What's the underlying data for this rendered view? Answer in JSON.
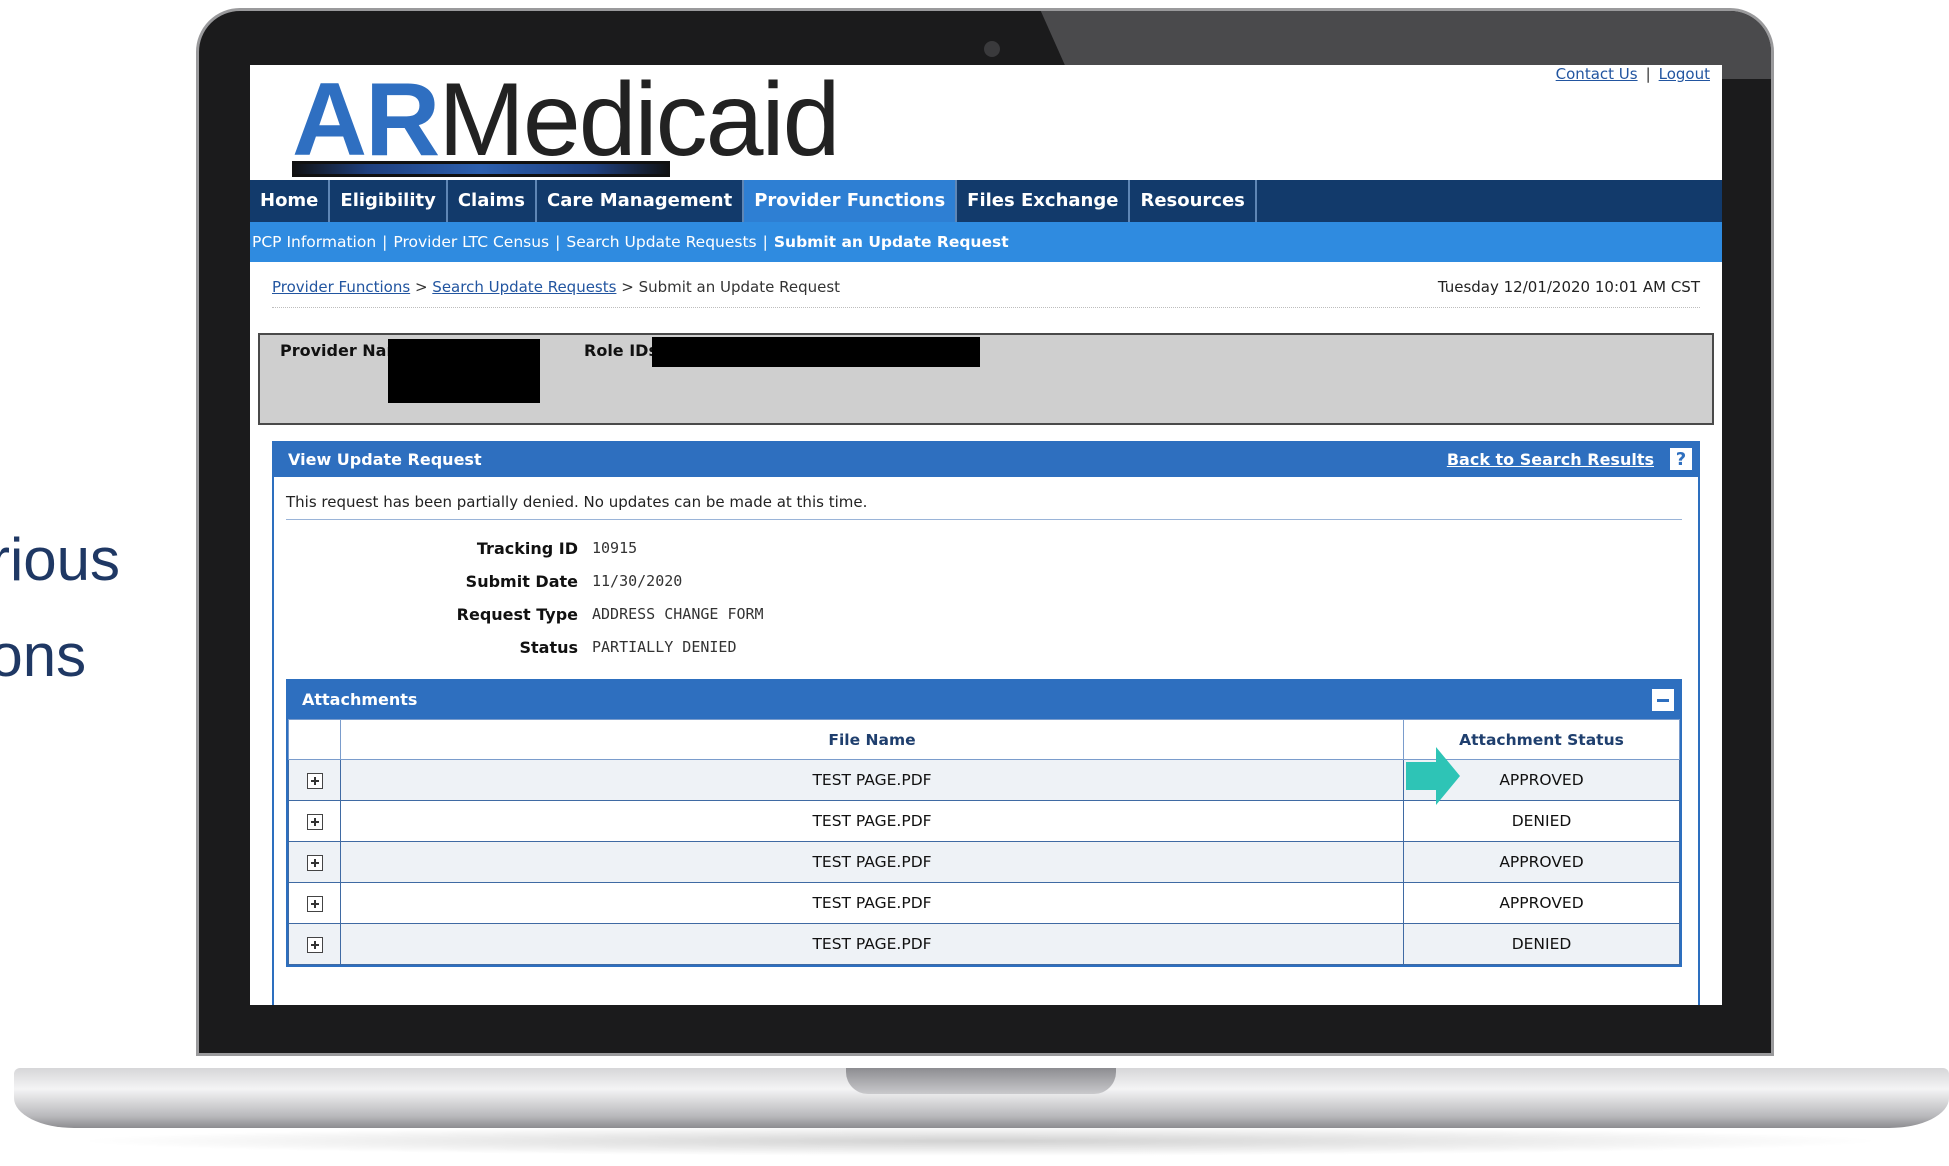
{
  "slide": {
    "line1": "rious",
    "line2": "ions"
  },
  "header": {
    "logo_ar": "AR",
    "logo_rest": "Medicaid",
    "contact_label": "Contact Us",
    "logout_label": "Logout",
    "separator": "|"
  },
  "mainnav": {
    "items": [
      "Home",
      "Eligibility",
      "Claims",
      "Care Management",
      "Provider Functions",
      "Files Exchange",
      "Resources"
    ],
    "active": "Provider Functions"
  },
  "subnav": {
    "items": [
      "PCP Information",
      "Provider LTC Census",
      "Search Update Requests",
      "Submit an Update Request"
    ],
    "separator": "|"
  },
  "breadcrumb": {
    "link1": "Provider Functions",
    "link2": "Search Update Requests",
    "current": "Submit an Update Request",
    "separator": ">"
  },
  "datetime": "Tuesday 12/01/2020 10:01 AM CST",
  "provider": {
    "name_label": "Provider Name",
    "roles_label": "Role IDs"
  },
  "panel": {
    "title": "View Update Request",
    "back_label": "Back to Search Results",
    "help_icon": "?",
    "notice": "This request has been partially denied. No updates can be made at this time."
  },
  "details": {
    "tracking_label": "Tracking ID",
    "tracking_value": "10915",
    "submit_label": "Submit Date",
    "submit_value": "11/30/2020",
    "type_label": "Request Type",
    "type_value": "ADDRESS CHANGE FORM",
    "status_label": "Status",
    "status_value": "PARTIALLY DENIED"
  },
  "attachments": {
    "title": "Attachments",
    "columns": [
      "",
      "File Name",
      "Attachment Status"
    ],
    "rows": [
      {
        "file": "TEST PAGE.PDF",
        "status": "APPROVED"
      },
      {
        "file": "TEST PAGE.PDF",
        "status": "DENIED"
      },
      {
        "file": "TEST PAGE.PDF",
        "status": "APPROVED"
      },
      {
        "file": "TEST PAGE.PDF",
        "status": "APPROVED"
      },
      {
        "file": "TEST PAGE.PDF",
        "status": "DENIED"
      }
    ]
  },
  "colors": {
    "nav_dark": "#123a6b",
    "nav_active": "#2e7fd3",
    "subnav": "#2f8be0",
    "panel_blue": "#2e6fbf",
    "arrow": "#2ec4b6"
  }
}
